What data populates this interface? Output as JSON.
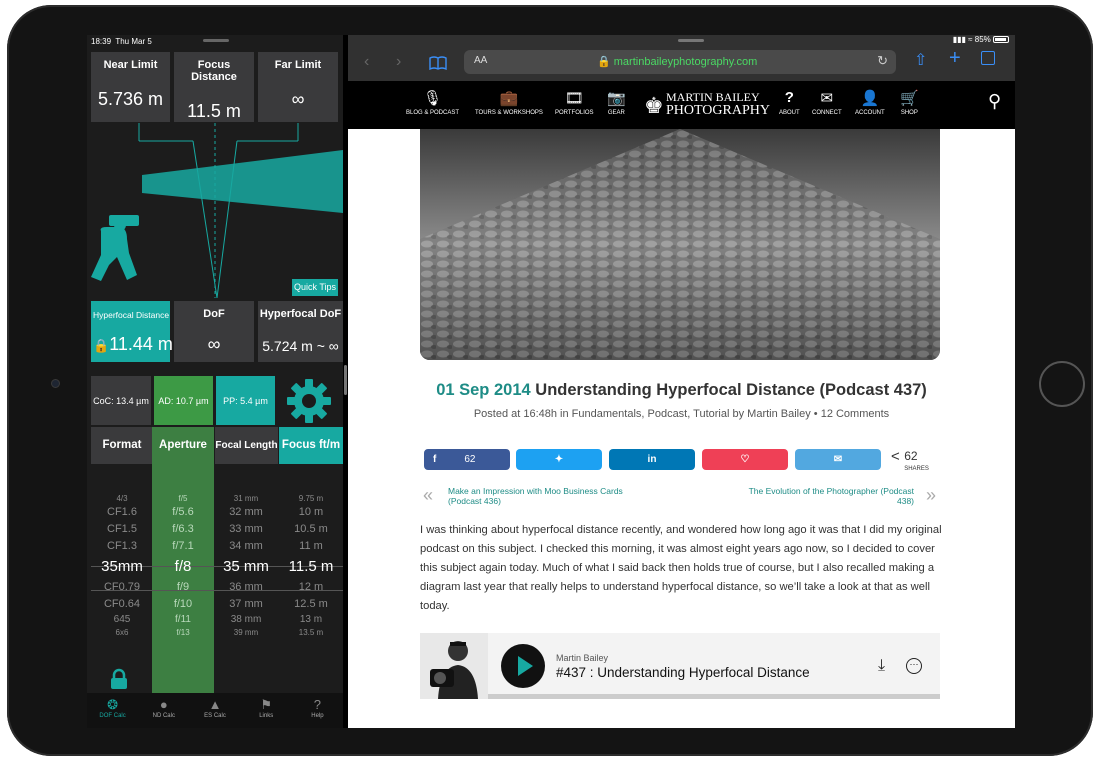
{
  "status_bar_left": {
    "time": "18:39",
    "date": "Thu Mar 5"
  },
  "status_bar_right": {
    "battery": "85%"
  },
  "dof_app": {
    "header": {
      "near_label": "Near Limit",
      "near_value": "5.736 m",
      "focus_label": "Focus Distance",
      "focus_value": "11.5 m",
      "far_label": "Far Limit",
      "far_value": "∞"
    },
    "quick_tips": "Quick Tips",
    "results": {
      "hyperfocal_label": "Hyperfocal Distance",
      "hyperfocal_value": "11.44 m",
      "dof_label": "DoF",
      "dof_value": "∞",
      "hyperfocal_dof_label": "Hyperfocal DoF",
      "hyperfocal_dof_value": "5.724 m ~ ∞"
    },
    "params": {
      "coc": "CoC: 13.4 µm",
      "ad": "AD: 10.7 µm",
      "pp": "PP: 5.4 µm"
    },
    "pickers": {
      "format_label": "Format",
      "aperture_label": "Aperture",
      "focal_label": "Focal Length",
      "focus_label": "Focus ft/m"
    },
    "format_wheel": [
      "4/3",
      "CF1.6",
      "CF1.5",
      "CF1.3",
      "35mm",
      "CF0.79",
      "CF0.64",
      "645",
      "6x6"
    ],
    "aperture_wheel": [
      "f/5",
      "f/5.6",
      "f/6.3",
      "f/7.1",
      "f/8",
      "f/9",
      "f/10",
      "f/11",
      "f/13"
    ],
    "focal_wheel": [
      "31 mm",
      "32 mm",
      "33 mm",
      "34 mm",
      "35 mm",
      "36 mm",
      "37 mm",
      "38 mm",
      "39 mm"
    ],
    "focus_wheel": [
      "9.75 m",
      "10 m",
      "10.5 m",
      "11 m",
      "11.5 m",
      "12 m",
      "12.5 m",
      "13 m",
      "13.5 m"
    ],
    "tabs": [
      {
        "label": "DOF Calc",
        "icon": "aperture-icon"
      },
      {
        "label": "ND Calc",
        "icon": "filter-icon"
      },
      {
        "label": "ES Calc",
        "icon": "triangle-icon"
      },
      {
        "label": "Links",
        "icon": "link-icon"
      },
      {
        "label": "Help",
        "icon": "help-icon"
      }
    ]
  },
  "browser": {
    "aa_label": "AA",
    "url": "martinbaileyphotography.com",
    "nav": {
      "blog": "BLOG & PODCAST",
      "tours": "TOURS & WORKSHOPS",
      "portfolios": "PORTFOLIOS",
      "gear": "GEAR",
      "logo_line1": "MARTIN BAILEY",
      "logo_line2": "PHOTOGRAPHY",
      "about": "ABOUT",
      "connect": "CONNECT",
      "account": "ACCOUNT",
      "shop": "SHOP"
    },
    "post": {
      "date": "01 Sep 2014",
      "title": "Understanding Hyperfocal Distance (Podcast 437)",
      "meta": "Posted at 16:48h in Fundamentals, Podcast, Tutorial by Martin Bailey • 12 Comments",
      "facebook_count": "62",
      "share_total": "62",
      "shares_label": "SHARES",
      "prev_link": "Make an Impression with Moo Business Cards (Podcast 436)",
      "next_link": "The Evolution of the Photographer (Podcast 438)",
      "body": "I was thinking about hyperfocal distance recently, and wondered how long ago it was that I did my original podcast on this subject. I checked this morning, it was almost eight years ago now, so I decided to cover this subject again today. Much of what I said back then holds true of course, but I also recalled making a diagram last year that really helps to understand hyperfocal distance, so we’ll take a look at that as well today."
    },
    "player": {
      "author": "Martin Bailey",
      "title": "#437 : Understanding Hyperfocal Distance"
    }
  },
  "colors": {
    "teal": "#17a9a1",
    "green": "#3d9a45",
    "post_date": "#1e8c86"
  }
}
